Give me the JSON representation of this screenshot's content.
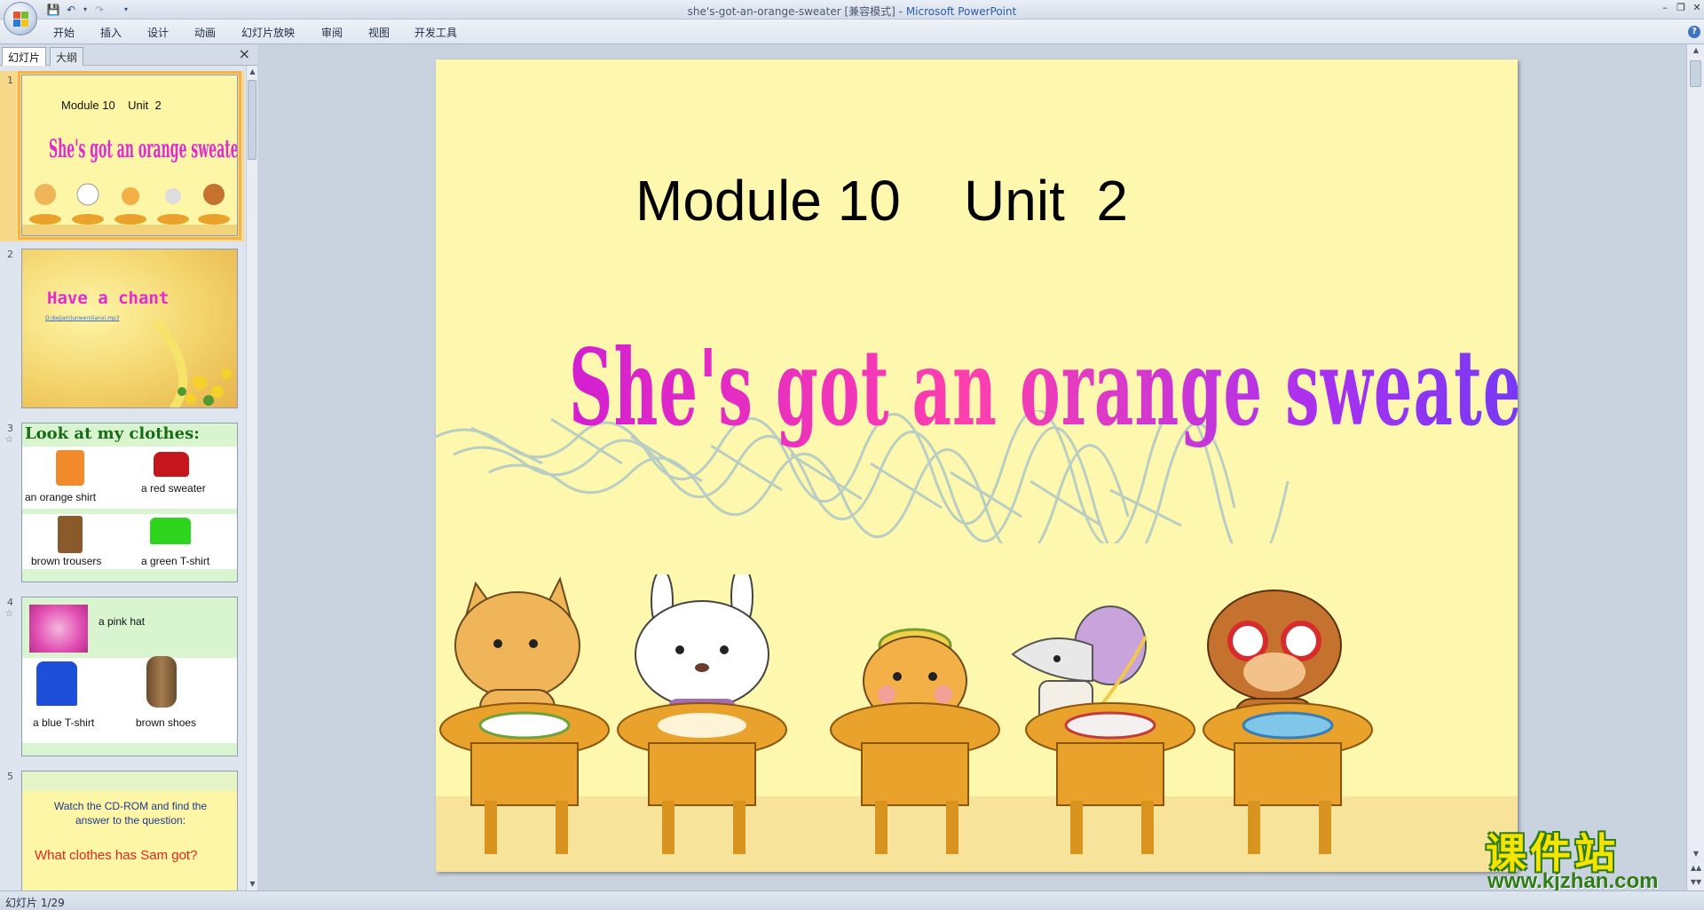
{
  "window": {
    "title_doc": "she's-got-an-orange-sweater [兼容模式]",
    "title_sep": " - ",
    "title_app": "Microsoft PowerPoint"
  },
  "ribbon": {
    "tabs": [
      "开始",
      "插入",
      "设计",
      "动画",
      "幻灯片放映",
      "审阅",
      "视图",
      "开发工具"
    ]
  },
  "panel": {
    "tab_slides": "幻灯片",
    "tab_outline": "大纲",
    "close": "×"
  },
  "thumbnails": [
    {
      "num": "1",
      "line1": "Module 10    Unit  2",
      "line2": "She's got an orange sweater."
    },
    {
      "num": "2",
      "title": "Have a chant",
      "link": "D:\\kejian\\lunwen\\lianxi.mp3"
    },
    {
      "num": "3",
      "title": "Look at my clothes:",
      "items": [
        "an orange shirt",
        "a red sweater",
        "brown trousers",
        "a green T-shirt"
      ]
    },
    {
      "num": "4",
      "items": [
        "a pink hat",
        "a blue T-shirt",
        "brown shoes"
      ]
    },
    {
      "num": "5",
      "line1": "Watch the CD-ROM and find the",
      "line2": "answer to the question:",
      "question": "What clothes has Sam got?"
    }
  ],
  "slide": {
    "module": "Module 10    Unit  2",
    "title": "She's got an orange sweater."
  },
  "status": {
    "text": "幻灯片 1/29"
  },
  "watermark": {
    "cn": "课件站",
    "url": "www.kjzhan.com"
  },
  "colors": {
    "slide_bg": "#fdf8ae",
    "title_magenta": "#e02bd2",
    "selection": "#f4b24a"
  }
}
